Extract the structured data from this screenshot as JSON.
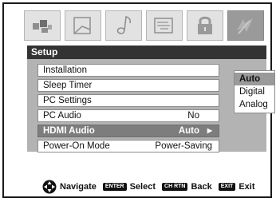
{
  "tabs": [
    {
      "name": "video-icon",
      "active": false
    },
    {
      "name": "picture-icon",
      "active": false
    },
    {
      "name": "audio-icon",
      "active": false
    },
    {
      "name": "preferences-icon",
      "active": false
    },
    {
      "name": "lock-icon",
      "active": false
    },
    {
      "name": "setup-icon",
      "active": true
    }
  ],
  "panel": {
    "title": "Setup"
  },
  "menu": {
    "items": [
      {
        "label": "Installation",
        "value": ""
      },
      {
        "label": "Sleep Timer",
        "value": ""
      },
      {
        "label": "PC Settings",
        "value": ""
      },
      {
        "label": "PC Audio",
        "value": "No"
      },
      {
        "label": "HDMI Audio",
        "value": "Auto",
        "selected": true
      },
      {
        "label": "Power-On Mode",
        "value": "Power-Saving"
      }
    ]
  },
  "submenu": {
    "options": [
      "Auto",
      "Digital",
      "Analog"
    ],
    "selected": "Auto"
  },
  "footer": {
    "navigate_label": "Navigate",
    "enter_key": "ENTER",
    "select_label": "Select",
    "chrtn_key": "CH RTN",
    "back_label": "Back",
    "exit_key": "EXIT",
    "exit_label": "Exit"
  },
  "colors": {
    "panel_bg": "#b3b3b3",
    "title_bar": "#333333",
    "selected_row": "#7d7d7d",
    "active_tab": "#9a9a9a"
  }
}
